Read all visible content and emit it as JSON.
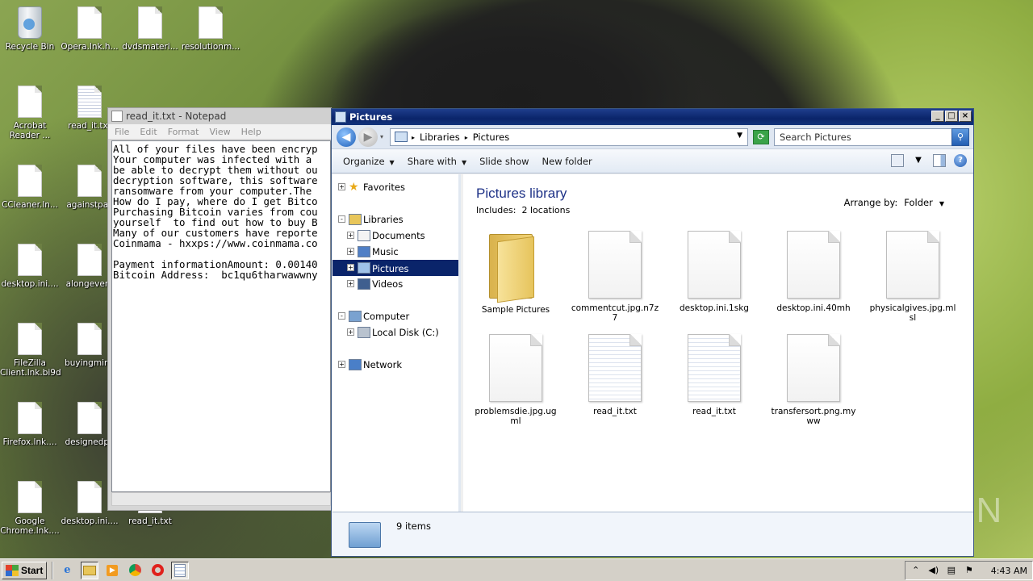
{
  "desktop": {
    "icons": [
      {
        "label": "Recycle Bin",
        "kind": "bin"
      },
      {
        "label": "Opera.lnk.h...",
        "kind": "doc"
      },
      {
        "label": "dvdsmateri...",
        "kind": "doc"
      },
      {
        "label": "resolutionm...",
        "kind": "doc"
      },
      {
        "label": "Acrobat Reader ...",
        "kind": "doc"
      },
      {
        "label": "read_it.txt",
        "kind": "lined"
      },
      {
        "label": "CCleaner.ln...",
        "kind": "doc"
      },
      {
        "label": "againstpas",
        "kind": "doc"
      },
      {
        "label": "desktop.ini....",
        "kind": "doc"
      },
      {
        "label": "alongevery",
        "kind": "doc"
      },
      {
        "label": "FileZilla Client.lnk.bi9d",
        "kind": "doc"
      },
      {
        "label": "buyingmini.",
        "kind": "doc"
      },
      {
        "label": "Firefox.lnk....",
        "kind": "doc"
      },
      {
        "label": "designedpa",
        "kind": "doc"
      },
      {
        "label": "Google Chrome.lnk....",
        "kind": "doc"
      },
      {
        "label": "desktop.ini....",
        "kind": "doc"
      },
      {
        "label": "read_it.txt",
        "kind": "lined"
      }
    ],
    "watermark": "ANY RUN"
  },
  "notepad": {
    "title": "read_it.txt - Notepad",
    "menu": [
      "File",
      "Edit",
      "Format",
      "View",
      "Help"
    ],
    "text": "All of your files have been encryp\nYour computer was infected with a \nbe able to decrypt them without ou\ndecryption software, this software\nransomware from your computer.The \nHow do I pay, where do I get Bitco\nPurchasing Bitcoin varies from cou\nyourself  to find out how to buy B\nMany of our customers have reporte\nCoinmama - hxxps://www.coinmama.co\n\nPayment informationAmount: 0.00140\nBitcoin Address:  bc1qu6tharwawwny"
  },
  "explorer": {
    "title": "Pictures",
    "caption_buttons": [
      "_",
      "□",
      "×"
    ],
    "breadcrumb": [
      "Libraries",
      "Pictures"
    ],
    "search_placeholder": "Search Pictures",
    "commands": [
      {
        "label": "Organize",
        "dropdown": true
      },
      {
        "label": "Share with",
        "dropdown": true
      },
      {
        "label": "Slide show",
        "dropdown": false
      },
      {
        "label": "New folder",
        "dropdown": false
      }
    ],
    "nav": [
      {
        "label": "Favorites",
        "level": 0,
        "exp": "+",
        "icon": "star-icon"
      },
      {
        "label": "Libraries",
        "level": 0,
        "exp": "-",
        "icon": "libraries-icon"
      },
      {
        "label": "Documents",
        "level": 1,
        "exp": "+",
        "icon": "documents-icon"
      },
      {
        "label": "Music",
        "level": 1,
        "exp": "+",
        "icon": "music-icon"
      },
      {
        "label": "Pictures",
        "level": 1,
        "exp": "+",
        "icon": "pictures-icon",
        "selected": true
      },
      {
        "label": "Videos",
        "level": 1,
        "exp": "+",
        "icon": "videos-icon"
      },
      {
        "label": "Computer",
        "level": 0,
        "exp": "-",
        "icon": "computer-icon"
      },
      {
        "label": "Local Disk (C:)",
        "level": 1,
        "exp": "+",
        "icon": "disk-icon"
      },
      {
        "label": "Network",
        "level": 0,
        "exp": "+",
        "icon": "network-icon"
      }
    ],
    "library_title": "Pictures library",
    "includes_label": "Includes:",
    "includes_value": "2 locations",
    "arrange_label": "Arrange by:",
    "arrange_value": "Folder",
    "files": [
      {
        "name": "Sample Pictures",
        "kind": "folder"
      },
      {
        "name": "commentcut.jpg.n7z7",
        "kind": "page"
      },
      {
        "name": "desktop.ini.1skg",
        "kind": "page"
      },
      {
        "name": "desktop.ini.40mh",
        "kind": "page"
      },
      {
        "name": "physicalgives.jpg.mlsl",
        "kind": "page"
      },
      {
        "name": "problemsdie.jpg.ugml",
        "kind": "page"
      },
      {
        "name": "read_it.txt",
        "kind": "lined"
      },
      {
        "name": "read_it.txt",
        "kind": "lined"
      },
      {
        "name": "transfersort.png.myww",
        "kind": "page"
      }
    ],
    "status": "9 items"
  },
  "taskbar": {
    "start_label": "Start",
    "clock": "4:43 AM",
    "quick": [
      "ie-icon",
      "explorer-icon",
      "media-player-icon",
      "chrome-icon",
      "opera-icon",
      "notepad-icon"
    ]
  }
}
